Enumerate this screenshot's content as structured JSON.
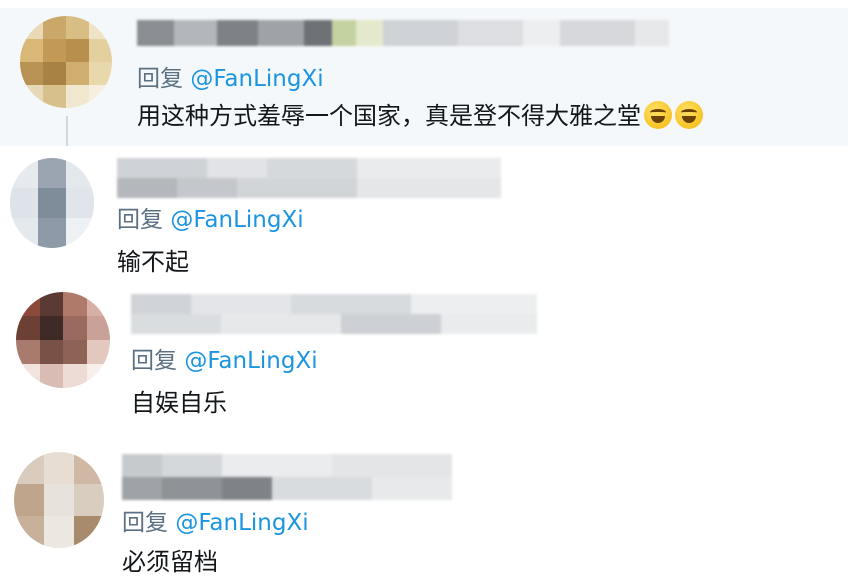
{
  "replies": [
    {
      "reply_prefix": "回复",
      "mention": "@FanLingXi",
      "text": "用这种方式羞辱一个国家，真是登不得大雅之堂",
      "emoji": [
        "tears-of-joy-emoji",
        "tears-of-joy-emoji"
      ]
    },
    {
      "reply_prefix": "回复",
      "mention": "@FanLingXi",
      "text": "输不起"
    },
    {
      "reply_prefix": "回复",
      "mention": "@FanLingXi",
      "text": "自娱自乐"
    },
    {
      "reply_prefix": "回复",
      "mention": "@FanLingXi",
      "text": "必须留档"
    }
  ],
  "colors": {
    "mention": "#1b95e0",
    "reply_prefix": "#5b7083",
    "text": "#14171a",
    "highlight_bg": "#f5f8fa"
  }
}
